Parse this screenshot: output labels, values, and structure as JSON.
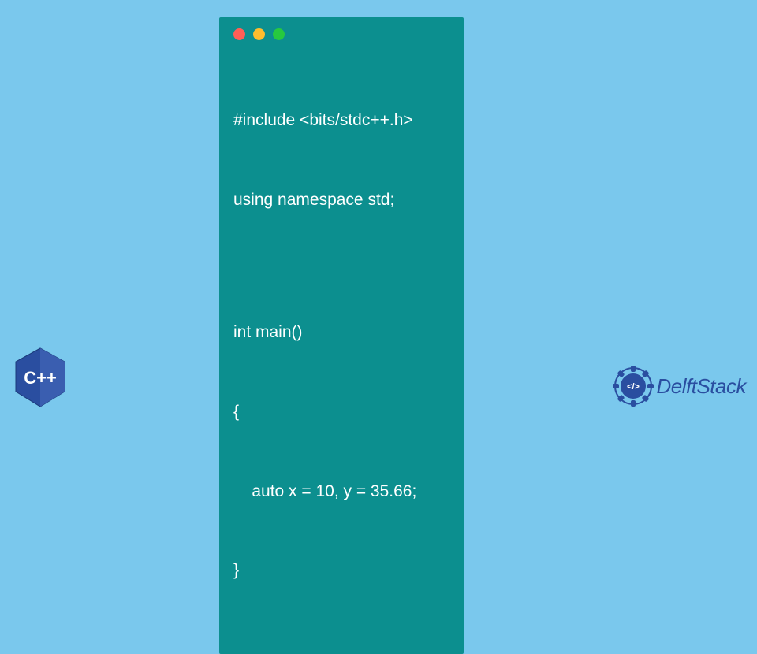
{
  "code": {
    "lines": [
      "#include <bits/stdc++.h>",
      "using namespace std;",
      "",
      "int main()",
      "{",
      "    auto x = 10, y = 35.66;",
      "}"
    ]
  },
  "badges": {
    "cpp_label": "C++",
    "brand_name": "DelftStack"
  },
  "colors": {
    "bg": "#7ac8ed",
    "window": "#0c8f8f",
    "code_text": "#ffffff",
    "cpp_badge": "#2a4ea0",
    "brand": "#2a4ea0"
  }
}
